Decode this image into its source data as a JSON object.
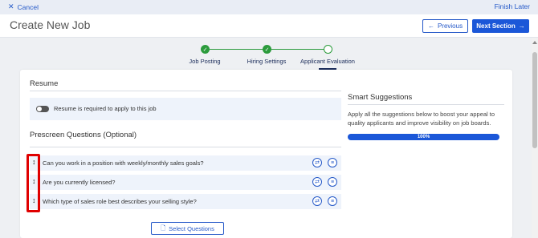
{
  "topbar": {
    "cancel_label": "Cancel",
    "finish_label": "Finish Later"
  },
  "header": {
    "title": "Create New Job",
    "previous_label": "Previous",
    "next_label": "Next Section"
  },
  "stepper": {
    "steps": [
      {
        "label": "Job Posting",
        "status": "complete"
      },
      {
        "label": "Hiring Settings",
        "status": "complete"
      },
      {
        "label": "Applicant Evaluation",
        "status": "current"
      }
    ]
  },
  "resume": {
    "title": "Resume",
    "toggle_label": "Resume is required to apply to this job",
    "toggle_on": false
  },
  "prescreen": {
    "title": "Prescreen Questions (Optional)",
    "questions": [
      {
        "text": "Can you work in a position with weekly/monthly sales goals?"
      },
      {
        "text": "Are you currently licensed?"
      },
      {
        "text": "Which type of sales role best describes your selling style?"
      }
    ],
    "select_button_label": "Select Questions"
  },
  "smart": {
    "title": "Smart Suggestions",
    "description": "Apply all the suggestions below to boost your appeal to quality applicants and improve visibility on job boards.",
    "progress_label": "100%",
    "progress_value": 100
  },
  "colors": {
    "primary": "#1b57d8",
    "success": "#2b9b3c",
    "highlight": "#e00000",
    "row_bg": "#eef3fb"
  }
}
